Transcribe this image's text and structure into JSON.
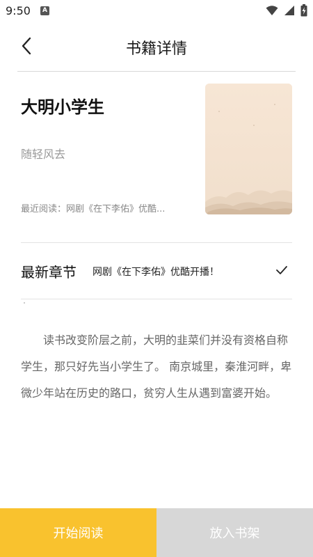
{
  "status_bar": {
    "time": "9:50",
    "notification_badge": "A",
    "icons": [
      "wifi-icon",
      "signal-icon",
      "battery-charging-icon"
    ]
  },
  "app_bar": {
    "title": "书籍详情",
    "back_icon": "chevron-left-icon"
  },
  "book": {
    "title": "大明小学生",
    "author": "随轻风去",
    "recent_read": "最近阅读：网剧《在下李佑》优酷...",
    "cover_icon": "book-cover-image"
  },
  "latest": {
    "label": "最新章节",
    "chapter": "网剧《在下李佑》优酷开播！",
    "icon": "checkmark-icon"
  },
  "description": "读书改变阶层之前，大明的韭菜们并没有资格自称学生，那只好先当小学生了。 南京城里，秦淮河畔，卑微少年站在历史的路口，贫穷人生从遇到富婆开始。",
  "actions": {
    "start_reading": "开始阅读",
    "add_to_shelf": "放入书架"
  },
  "colors": {
    "accent": "#f9c22e",
    "disabled": "#d7d7d7",
    "cover_bg": "#f5e6d6"
  }
}
